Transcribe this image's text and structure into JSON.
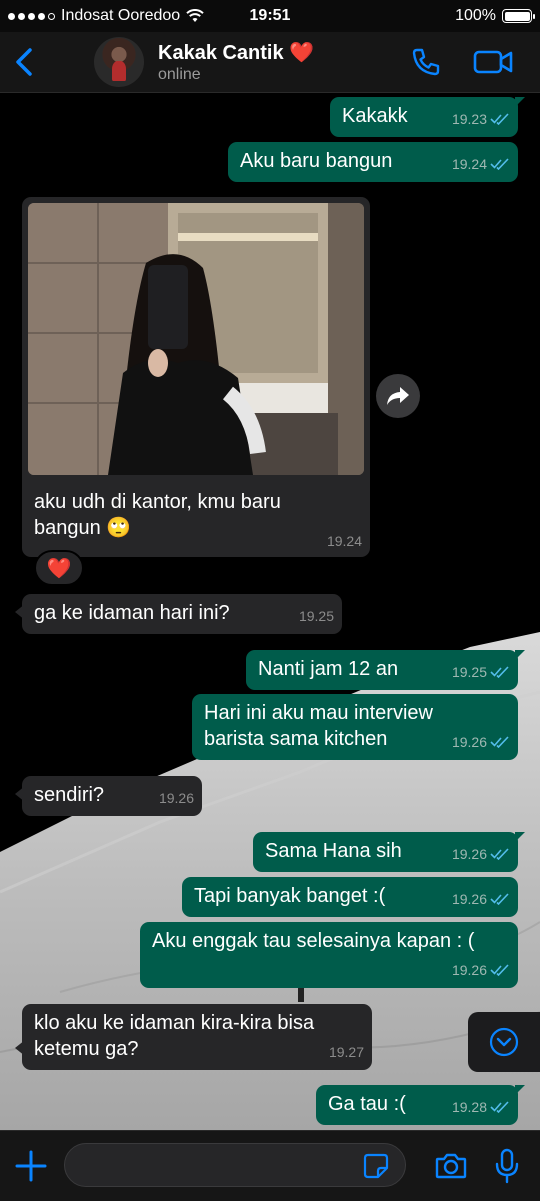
{
  "status_bar": {
    "carrier": "Indosat Ooredoo",
    "time": "19:51",
    "battery": "100%"
  },
  "header": {
    "contact_name": "Kakak Cantik ❤️",
    "status": "online"
  },
  "messages": [
    {
      "text": "Kakakk",
      "time": "19.23"
    },
    {
      "text": "Aku baru bangun",
      "time": "19.24"
    },
    {
      "text": "aku udh di kantor, kmu baru bangun 🙄",
      "time": "19.24"
    },
    {
      "text": "ga ke idaman hari ini?",
      "time": "19.25"
    },
    {
      "text": "Nanti jam 12 an",
      "time": "19.25"
    },
    {
      "text": "Hari ini aku mau interview barista sama kitchen",
      "time": "19.26"
    },
    {
      "text": "sendiri?",
      "time": "19.26"
    },
    {
      "text": "Sama Hana sih",
      "time": "19.26"
    },
    {
      "text": "Tapi banyak banget :(",
      "time": "19.26"
    },
    {
      "text": "Aku enggak tau selesainya kapan : (",
      "time": "19.26"
    },
    {
      "text": "klo aku ke idaman kira-kira bisa ketemu ga?",
      "time": "19.27"
    },
    {
      "text": "Ga tau :(",
      "time": "19.28"
    }
  ],
  "reaction": "❤️",
  "composer": {
    "placeholder": ""
  },
  "colors": {
    "accent": "#0a84ff",
    "outgoing": "#005c4b",
    "incoming": "#262628",
    "read_tick": "#53bdeb"
  }
}
